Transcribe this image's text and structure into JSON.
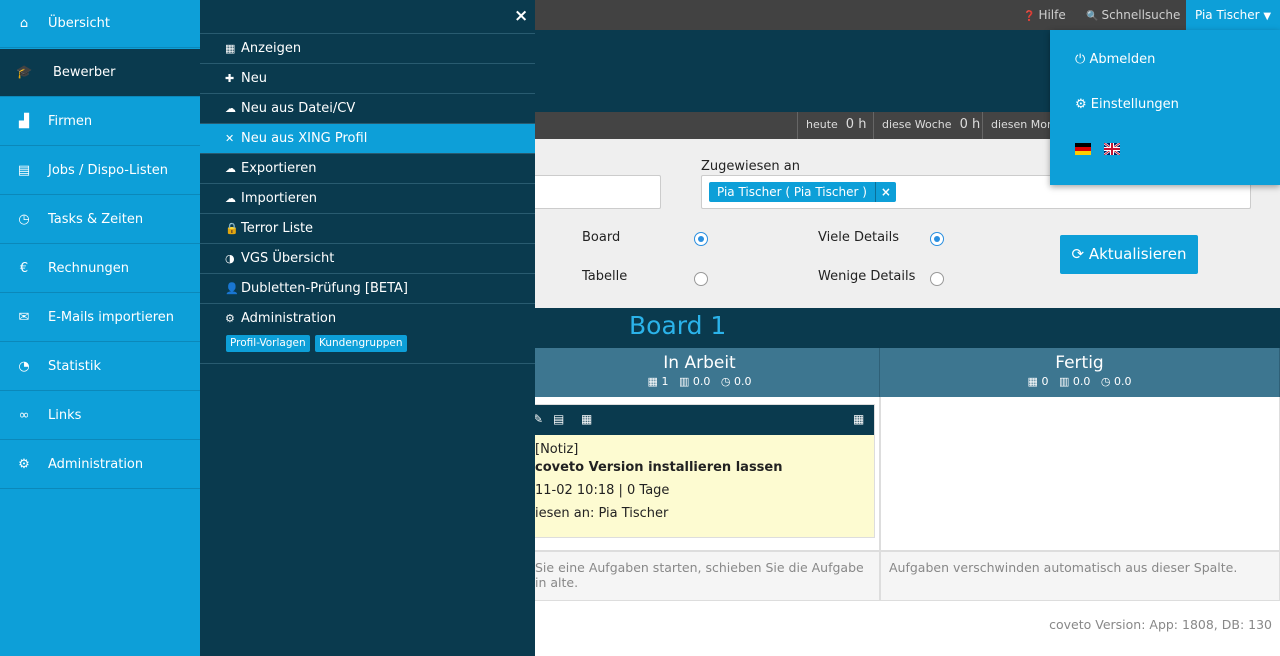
{
  "topbar": {
    "help_label": "Hilfe",
    "search_label": "Schnellsuche",
    "user_label": "Pia Tischer"
  },
  "timebar": {
    "today_label": "heute",
    "today_value": "0 h",
    "week_label": "diese Woche",
    "week_value": "0 h",
    "month_label": "diesen Mona"
  },
  "filter": {
    "assigned_label": "Zugewiesen an",
    "assigned_tag": "Pia Tischer ( Pia Tischer )",
    "tag_remove": "×",
    "view_board": "Board",
    "view_table": "Tabelle",
    "detail_many": "Viele Details",
    "detail_few": "Wenige Details",
    "refresh_label": "Aktualisieren"
  },
  "board": {
    "title": "Board 1",
    "columns": [
      {
        "name": "In Arbeit",
        "count": "1",
        "stat1": "0.0",
        "stat2": "0.0",
        "footer": "Sie eine Aufgaben starten, schieben Sie die Aufgabe in alte."
      },
      {
        "name": "Fertig",
        "count": "0",
        "stat1": "0.0",
        "stat2": "0.0",
        "footer": "Aufgaben verschwinden automatisch aus dieser Spalte."
      }
    ],
    "card": {
      "type": "[Notiz]",
      "title": "coveto Version installieren lassen",
      "date": "11-02 10:18 | 0 Tage",
      "assigned": "iesen an: Pia Tischer"
    }
  },
  "version_text": "coveto Version: App: 1808, DB: 130",
  "sidebar": {
    "items": [
      {
        "label": "Übersicht",
        "icon": "home-icon"
      },
      {
        "label": "Bewerber",
        "icon": "graduation-cap-icon"
      },
      {
        "label": "Firmen",
        "icon": "factory-icon"
      },
      {
        "label": "Jobs / Dispo-Listen",
        "icon": "newspaper-icon"
      },
      {
        "label": "Tasks & Zeiten",
        "icon": "clock-icon"
      },
      {
        "label": "Rechnungen",
        "icon": "euro-icon"
      },
      {
        "label": "E-Mails importieren",
        "icon": "envelope-icon"
      },
      {
        "label": "Statistik",
        "icon": "pie-chart-icon"
      },
      {
        "label": "Links",
        "icon": "link-icon"
      },
      {
        "label": "Administration",
        "icon": "gears-icon"
      }
    ]
  },
  "submenu": {
    "close": "×",
    "items": [
      {
        "label": "Anzeigen",
        "icon": "table-icon"
      },
      {
        "label": "Neu",
        "icon": "plus-icon"
      },
      {
        "label": "Neu aus Datei/CV",
        "icon": "cloud-upload-icon"
      },
      {
        "label": "Neu aus XING Profil",
        "icon": "xing-icon"
      },
      {
        "label": "Exportieren",
        "icon": "cloud-download-icon"
      },
      {
        "label": "Importieren",
        "icon": "cloud-upload-icon"
      },
      {
        "label": "Terror Liste",
        "icon": "lock-icon"
      },
      {
        "label": "VGS Übersicht",
        "icon": "dashboard-icon"
      },
      {
        "label": "Dubletten-Prüfung [BETA]",
        "icon": "user-times-icon"
      },
      {
        "label": "Administration",
        "icon": "gears-icon"
      }
    ],
    "tags": [
      "Profil-Vorlagen",
      "Kundengruppen"
    ]
  },
  "user_menu": {
    "logout": "Abmelden",
    "settings": "Einstellungen"
  },
  "colors": {
    "primary": "#0d9fd8",
    "dark": "#0a3a4e",
    "column_header": "#3d7690",
    "card": "#fdfbd1"
  }
}
